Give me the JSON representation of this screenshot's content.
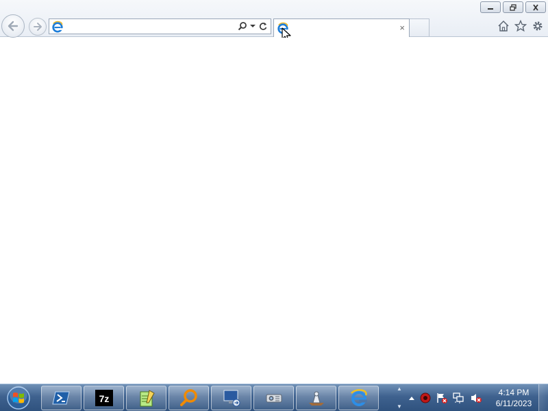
{
  "browser": {
    "address": {
      "value": "",
      "ie_icon": "ie-logo-icon"
    },
    "address_tools": [
      "search-icon",
      "dropdown-arrow-icon",
      "refresh-icon"
    ],
    "tab": {
      "title": "",
      "close_label": "×",
      "ie_icon": "ie-logo-icon"
    },
    "command_icons": [
      "home-icon",
      "favorites-star-icon",
      "settings-gear-icon"
    ],
    "window_controls": [
      "minimize-icon",
      "restore-icon",
      "close-icon"
    ]
  },
  "taskbar": {
    "start_icon": "windows-orb-icon",
    "pinned": [
      {
        "name": "powershell",
        "icon": "powershell-icon"
      },
      {
        "name": "7-zip",
        "icon": "7zip-icon",
        "label": "7z"
      },
      {
        "name": "notepad-plus-plus",
        "icon": "notepadpp-icon"
      },
      {
        "name": "search-tool",
        "icon": "magnifier-icon"
      },
      {
        "name": "remote-desktop",
        "icon": "remote-desktop-icon"
      },
      {
        "name": "projector",
        "icon": "projector-icon"
      },
      {
        "name": "app-mixer",
        "icon": "mixer-icon"
      },
      {
        "name": "internet-explorer",
        "icon": "ie-logo-icon"
      }
    ],
    "tray_icons": [
      "show-hidden-icons-arrow",
      "red-circle-icon",
      "flag-error-icon",
      "network-error-icon",
      "volume-muted-icon"
    ],
    "clock": {
      "time": "4:14 PM",
      "date": "6/11/2023"
    }
  }
}
